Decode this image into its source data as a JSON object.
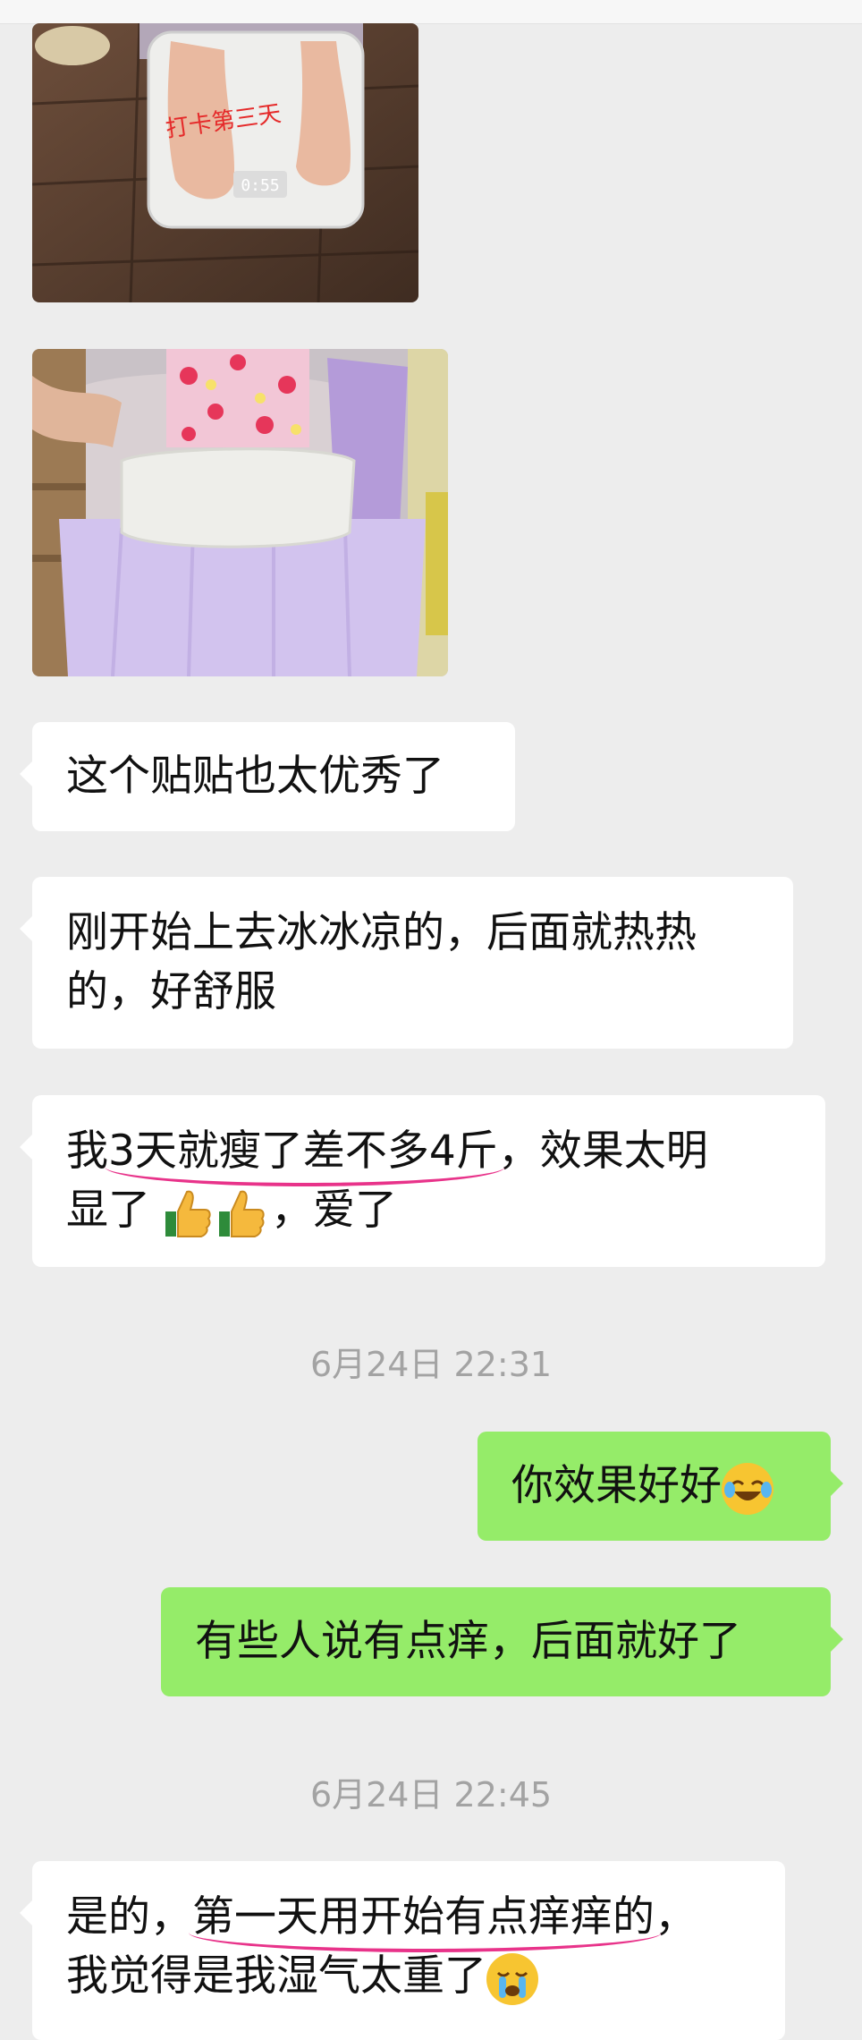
{
  "photo1": {
    "overlay_text": "打卡第三天",
    "scale_display": "0:55"
  },
  "messages": {
    "m1": "这个贴贴也太优秀了",
    "m2_line1": "刚开始上去冰冰凉的，后面就热热",
    "m2_line2": "的，好舒服",
    "m3_a": "我",
    "m3_u": "3天就瘦了差不多4斤",
    "m3_b": "，效果太明",
    "m3_c": "显了",
    "m3_d": "，爱了",
    "m4": "你效果好好",
    "m5": "有些人说有点痒，后面就好了",
    "m6_a": "是的，",
    "m6_u": "第一天用开始有点痒痒的",
    "m6_b": "，",
    "m6_c": "我觉得是我湿气太重了"
  },
  "timestamps": {
    "t1": "6月24日 22:31",
    "t2": "6月24日 22:45"
  },
  "emojis": [
    "thumbs-up",
    "thumbs-up",
    "rolling-on-floor-laughing",
    "crying-face"
  ],
  "colors": {
    "background": "#ededed",
    "outgoing_bubble": "#95ec69",
    "incoming_bubble": "#ffffff",
    "annotation_underline": "#e8338a"
  }
}
